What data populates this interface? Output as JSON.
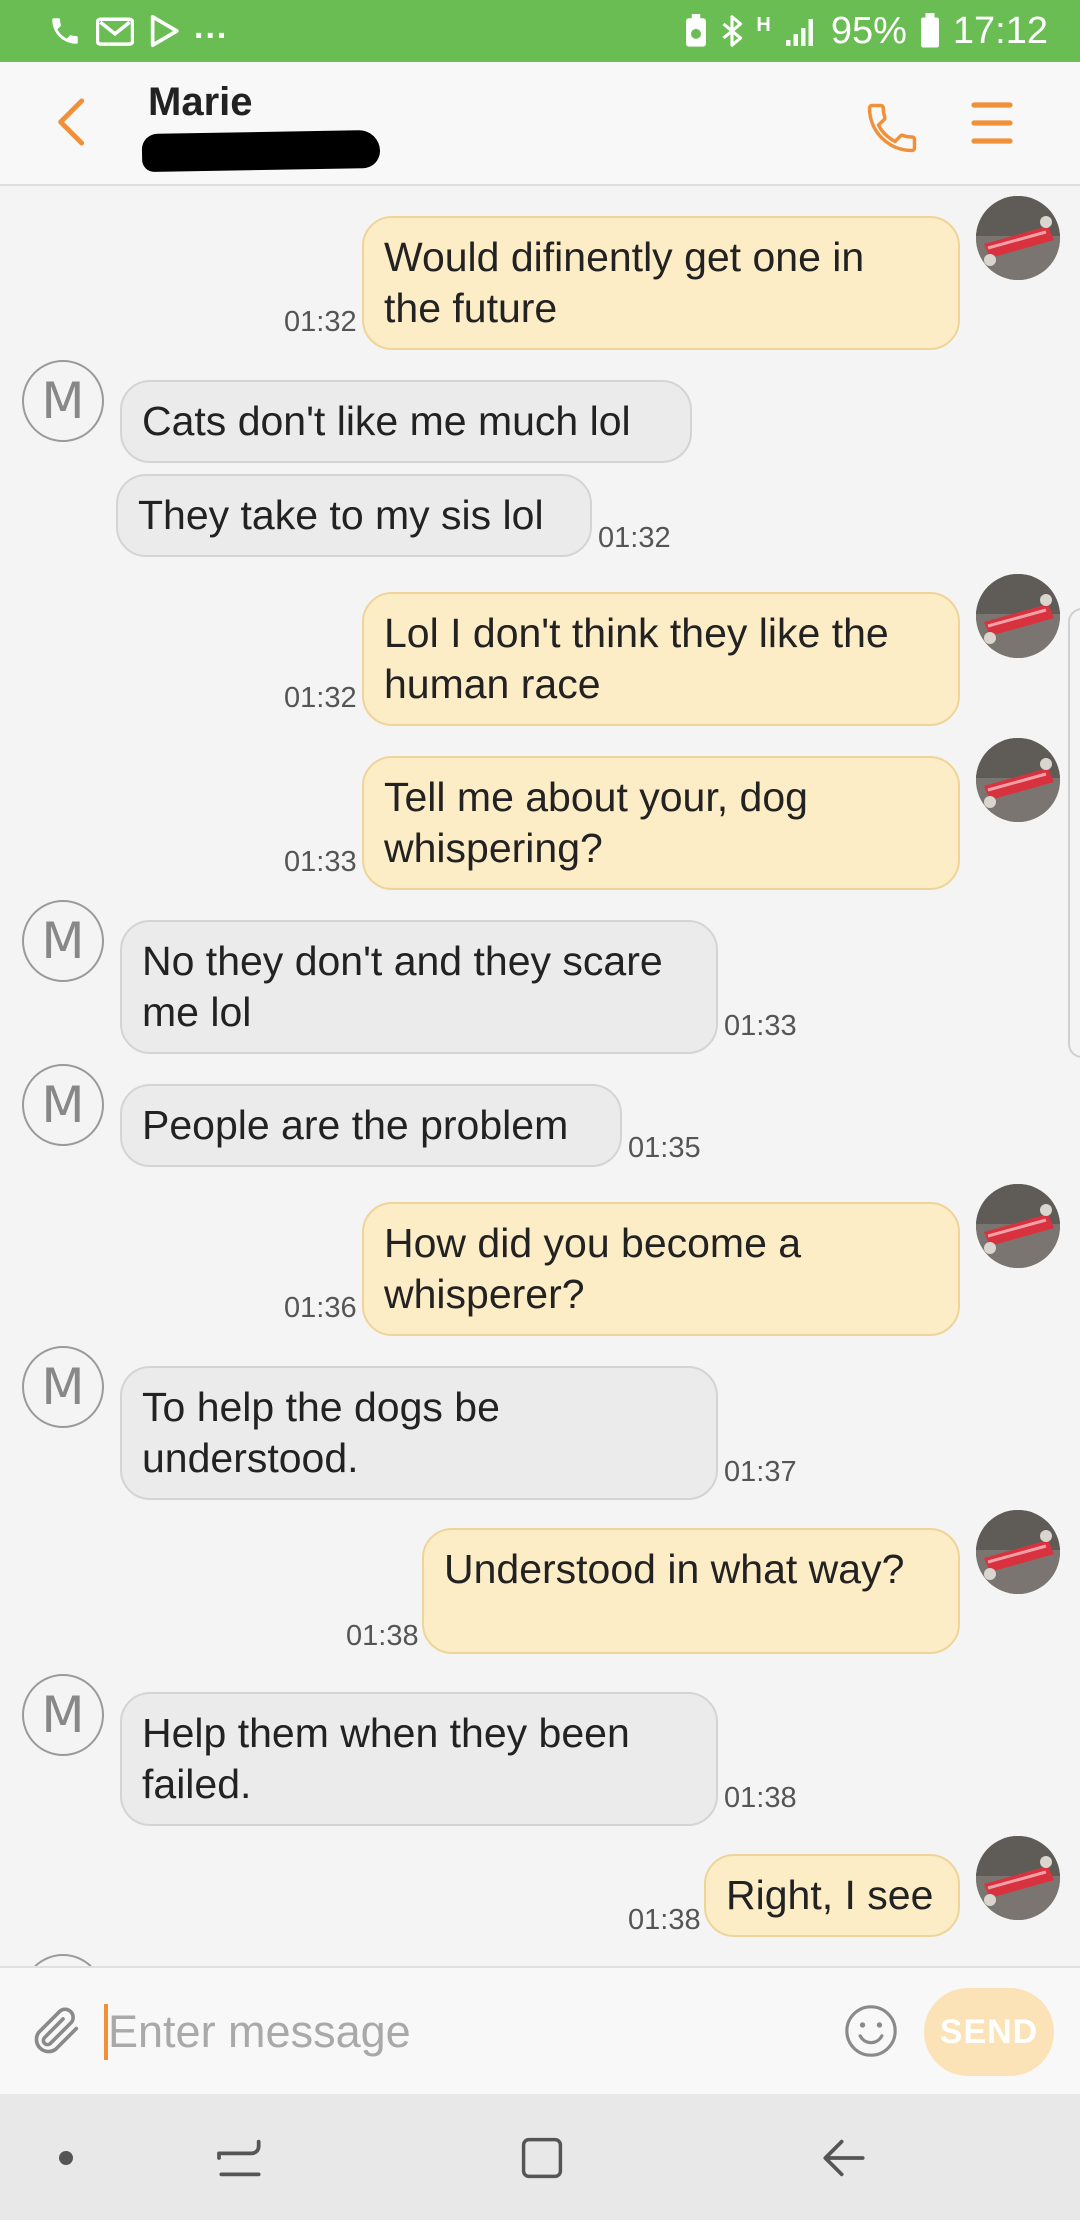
{
  "status_bar": {
    "battery_percent": "95%",
    "time": "17:12",
    "overflow": "...",
    "network_label": "H",
    "bar_color": "#6abd53"
  },
  "header": {
    "contact_name": "Marie",
    "accent_color": "#f0913a",
    "back_icon": "chevron-left-icon",
    "call_icon": "phone-icon",
    "menu_icon": "menu-icon"
  },
  "contact_initial": "M",
  "messages": [
    {
      "dir": "out",
      "text": "Would difinently get one in\nthe future",
      "time": "01:32"
    },
    {
      "dir": "in",
      "text": "Cats don't like me much lol",
      "time": ""
    },
    {
      "dir": "in",
      "text": "They take to my sis lol",
      "time": "01:32"
    },
    {
      "dir": "out",
      "text": "Lol I don't think they like the\nhuman race",
      "time": "01:32"
    },
    {
      "dir": "out",
      "text": "Tell me about your, dog\nwhispering?",
      "time": "01:33"
    },
    {
      "dir": "in",
      "text": "No they don't and they scare\nme lol",
      "time": "01:33"
    },
    {
      "dir": "in",
      "text": "People are the problem",
      "time": "01:35"
    },
    {
      "dir": "out",
      "text": "How did you become a\nwhisperer?",
      "time": "01:36"
    },
    {
      "dir": "in",
      "text": "To help the dogs be\nunderstood.",
      "time": "01:37"
    },
    {
      "dir": "out",
      "text": "Understood in what way?",
      "time": "01:38"
    },
    {
      "dir": "in",
      "text": "Help them when they been\nfailed.",
      "time": "01:38"
    },
    {
      "dir": "out",
      "text": "Right, I see",
      "time": "01:38"
    }
  ],
  "composer": {
    "placeholder": "Enter message",
    "send_label": "SEND",
    "attach_icon": "paperclip-icon",
    "emoji_icon": "smiley-icon"
  },
  "nav_bar": {
    "items": [
      "dot-icon",
      "recents-icon",
      "home-icon",
      "back-icon"
    ]
  },
  "colors": {
    "incoming_bubble": "#ebebeb",
    "outgoing_bubble": "#fdedc6",
    "send_button": "#fbe2b7"
  }
}
